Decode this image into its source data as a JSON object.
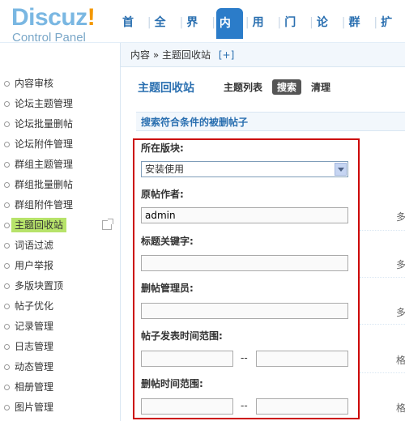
{
  "header": {
    "logo_word": "Discuz",
    "logo_excl": "!",
    "logo_sub": "Control Panel",
    "nav": [
      "首页",
      "全局",
      "界面",
      "内容",
      "用户",
      "门户",
      "论坛",
      "群组",
      "扩展"
    ],
    "active_nav": "内容"
  },
  "sidebar": {
    "items": [
      "内容审核",
      "论坛主题管理",
      "论坛批量删帖",
      "论坛附件管理",
      "群组主题管理",
      "群组批量删帖",
      "群组附件管理",
      "主题回收站",
      "词语过滤",
      "用户举报",
      "多版块置顶",
      "帖子优化",
      "记录管理",
      "日志管理",
      "动态管理",
      "相册管理",
      "图片管理"
    ],
    "active": "主题回收站"
  },
  "breadcrumb": {
    "section": "内容",
    "sep": "»",
    "page": "主题回收站",
    "add": "[+]"
  },
  "page": {
    "title": "主题回收站",
    "tabs": [
      "主题列表",
      "搜索",
      "清理"
    ],
    "active_tab": "搜索",
    "section_title": "搜索符合条件的被删帖子"
  },
  "form": {
    "forum_label": "所在版块:",
    "forum_value": "安装使用",
    "author_label": "原帖作者:",
    "author_value": "admin",
    "keyword_label": "标题关键字:",
    "keyword_value": "",
    "admin_label": "删帖管理员:",
    "admin_value": "",
    "post_time_label": "帖子发表时间范围:",
    "delete_time_label": "删帖时间范围:",
    "range_sep": "--"
  },
  "hints": {
    "h1": "多",
    "h2": "多",
    "h3": "多",
    "h4": "格",
    "h5": "格"
  },
  "colors": {
    "accent": "#2b7cc9",
    "active_menu": "#b7e36a",
    "highlight_border": "#cc0000"
  }
}
